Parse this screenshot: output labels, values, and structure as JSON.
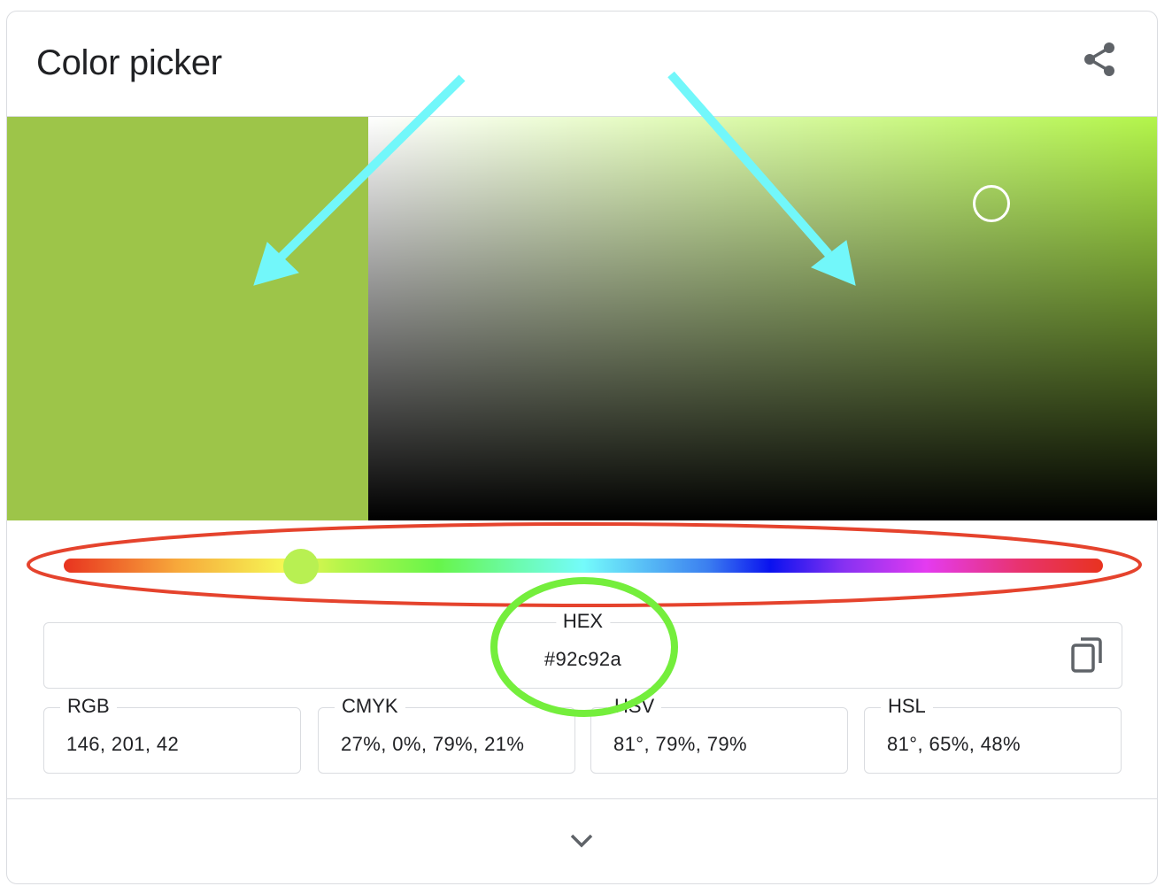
{
  "header": {
    "title": "Color picker",
    "share_icon": "share-icon"
  },
  "color": {
    "hex_value": "#92c92a",
    "swatch": "#9dc549",
    "hue_base": "#b3f54a",
    "hue_thumb": "#b8f052"
  },
  "fields": {
    "hex": {
      "label": "HEX",
      "value": "#92c92a",
      "copy_icon": "copy-icon"
    },
    "rgb": {
      "label": "RGB",
      "value": "146, 201, 42"
    },
    "cmyk": {
      "label": "CMYK",
      "value": "27%, 0%, 79%, 21%"
    },
    "hsv": {
      "label": "HSV",
      "value": "81°, 79%, 79%"
    },
    "hsl": {
      "label": "HSL",
      "value": "81°, 65%, 48%"
    }
  },
  "footer": {
    "expand_icon": "chevron-down-icon"
  },
  "annotations": {
    "arrow_color": "#72f7fa",
    "ellipse_red": "#e5432d",
    "ellipse_green": "#74ee3c"
  }
}
